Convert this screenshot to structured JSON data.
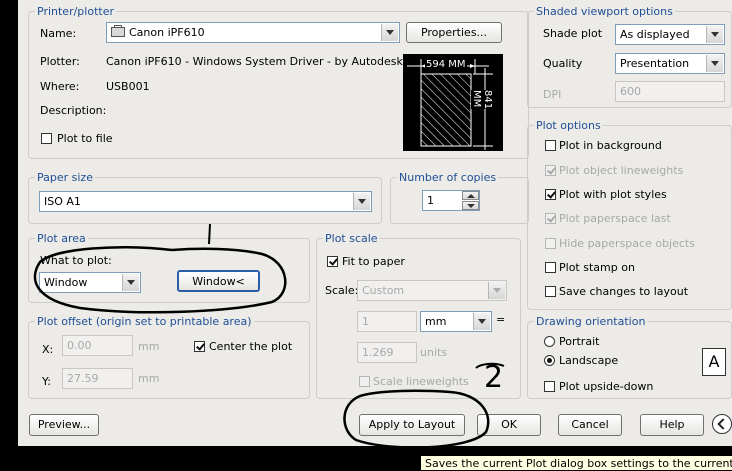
{
  "printer": {
    "group_title": "Printer/plotter",
    "name_label": "Name:",
    "name_value": "Canon iPF610",
    "properties_button": "Properties...",
    "plotter_label": "Plotter:",
    "plotter_value": "Canon iPF610 - Windows System Driver - by Autodesk",
    "where_label": "Where:",
    "where_value": "USB001",
    "description_label": "Description:",
    "plot_to_file": "Plot to file",
    "preview_width": "594 MM",
    "preview_height": "841 MM"
  },
  "paper_size": {
    "title": "Paper size",
    "value": "ISO A1"
  },
  "copies": {
    "title": "Number of copies",
    "value": "1"
  },
  "plot_area": {
    "title": "Plot area",
    "what_label": "What to plot:",
    "what_value": "Window",
    "window_button": "Window<"
  },
  "plot_offset": {
    "title": "Plot offset (origin set to printable area)",
    "x_label": "X:",
    "x_value": "0.00",
    "x_unit": "mm",
    "y_label": "Y:",
    "y_value": "27.59",
    "y_unit": "mm",
    "center_label": "Center the plot"
  },
  "plot_scale": {
    "title": "Plot scale",
    "fit_label": "Fit to paper",
    "scale_label": "Scale:",
    "scale_value": "Custom",
    "num_value": "1",
    "unit_value": "mm",
    "equals": "=",
    "den_value": "1.269",
    "den_unit": "units",
    "lineweights_label": "Scale lineweights"
  },
  "shaded": {
    "title": "Shaded viewport options",
    "shade_label": "Shade plot",
    "shade_value": "As displayed",
    "quality_label": "Quality",
    "quality_value": "Presentation",
    "dpi_label": "DPI",
    "dpi_value": "600"
  },
  "plot_options": {
    "title": "Plot options",
    "items": [
      {
        "label": "Plot in background",
        "checked": false,
        "enabled": true
      },
      {
        "label": "Plot object lineweights",
        "checked": true,
        "enabled": false
      },
      {
        "label": "Plot with plot styles",
        "checked": true,
        "enabled": true
      },
      {
        "label": "Plot paperspace last",
        "checked": true,
        "enabled": false
      },
      {
        "label": "Hide paperspace objects",
        "checked": false,
        "enabled": false
      },
      {
        "label": "Plot stamp on",
        "checked": false,
        "enabled": true
      },
      {
        "label": "Save changes to layout",
        "checked": false,
        "enabled": true
      }
    ]
  },
  "orientation": {
    "title": "Drawing orientation",
    "portrait": "Portrait",
    "landscape": "Landscape",
    "selected": "Landscape",
    "upside_down": "Plot upside-down",
    "icon_letter": "A"
  },
  "buttons": {
    "preview": "Preview...",
    "apply": "Apply to Layout",
    "ok": "OK",
    "cancel": "Cancel",
    "help": "Help"
  },
  "tooltip": "Saves the current Plot dialog box settings to the current layout.",
  "annotations": {
    "number_label": "2"
  }
}
